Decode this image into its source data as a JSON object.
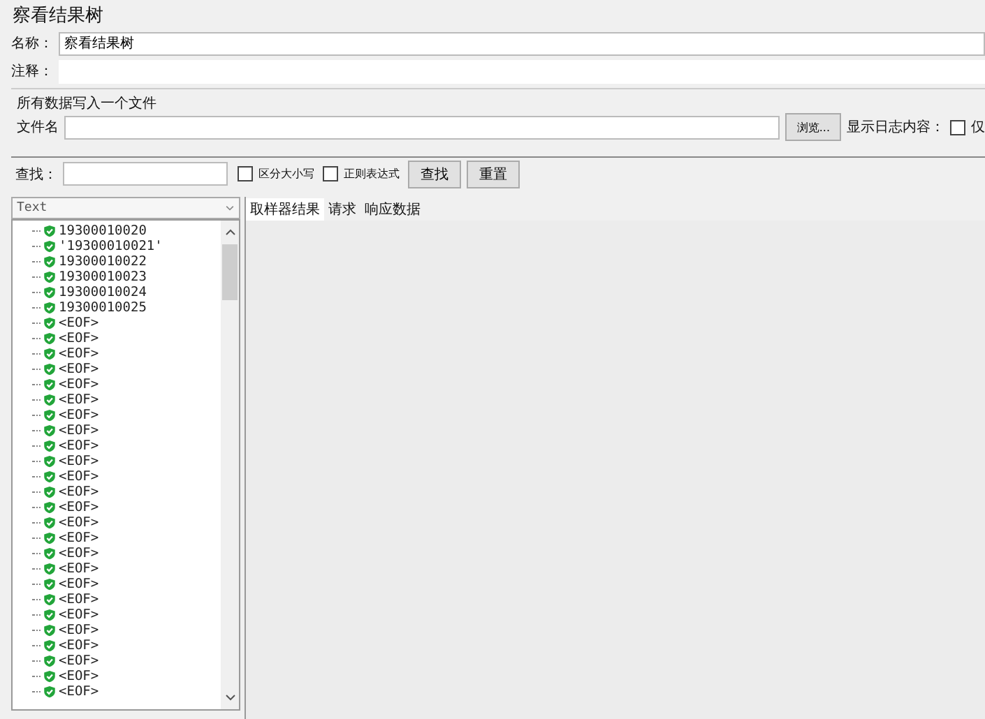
{
  "window": {
    "title": "察看结果树"
  },
  "name_field": {
    "label": "名称：",
    "value": "察看结果树"
  },
  "comment_field": {
    "label": "注释："
  },
  "file_group": {
    "title": "所有数据写入一个文件",
    "file_label": "文件名",
    "browse_button": "浏览...",
    "log_label": "显示日志内容：",
    "only_checkbox": {
      "label": "仅",
      "checked": false
    }
  },
  "search": {
    "label": "查找：",
    "case_checkbox": {
      "label": "区分大小写",
      "checked": false
    },
    "regex_checkbox": {
      "label": "正则表达式",
      "checked": false
    },
    "find_button": "查找",
    "reset_button": "重置"
  },
  "renderer": {
    "value": "Text"
  },
  "tree": {
    "items": [
      "19300010020",
      "'19300010021'",
      "19300010022",
      "19300010023",
      "19300010024",
      "19300010025",
      "<EOF>",
      "<EOF>",
      "<EOF>",
      "<EOF>",
      "<EOF>",
      "<EOF>",
      "<EOF>",
      "<EOF>",
      "<EOF>",
      "<EOF>",
      "<EOF>",
      "<EOF>",
      "<EOF>",
      "<EOF>",
      "<EOF>",
      "<EOF>",
      "<EOF>",
      "<EOF>",
      "<EOF>",
      "<EOF>",
      "<EOF>",
      "<EOF>",
      "<EOF>",
      "<EOF>",
      "<EOF>"
    ]
  },
  "tabs": [
    {
      "label": "取样器结果",
      "selected": true
    },
    {
      "label": "请求",
      "selected": false
    },
    {
      "label": "响应数据",
      "selected": false
    }
  ]
}
